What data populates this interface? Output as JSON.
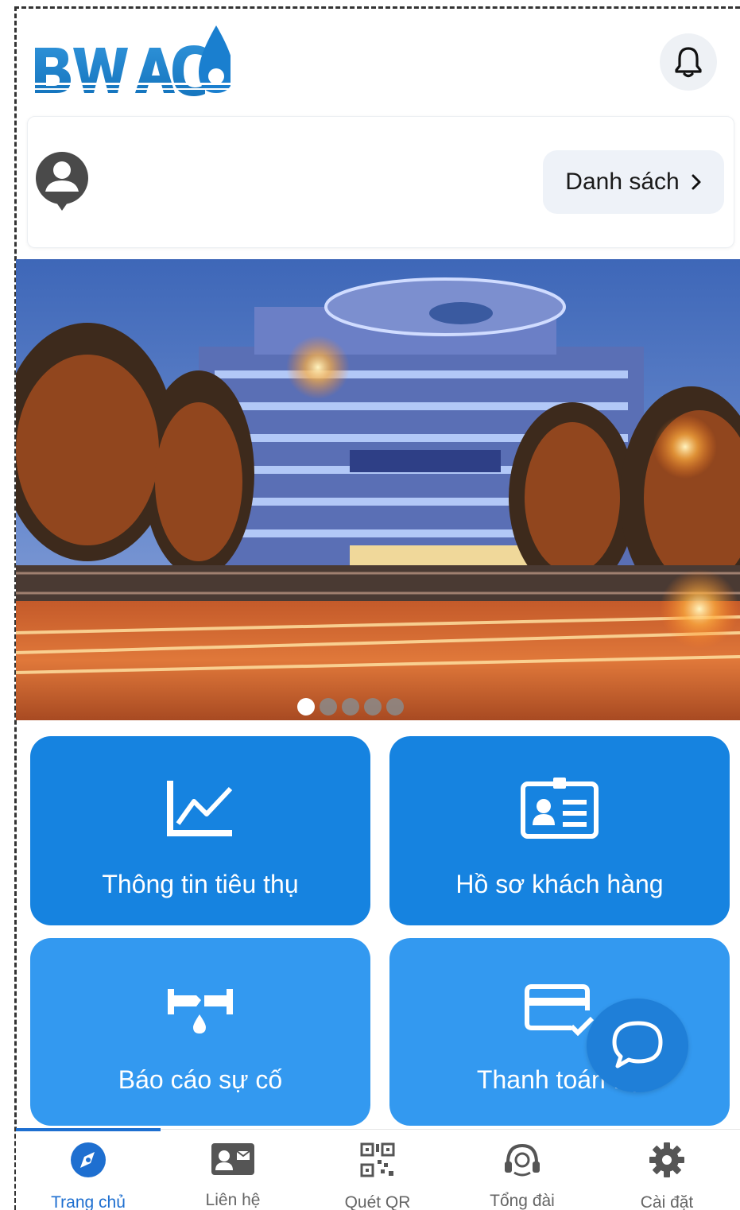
{
  "header": {
    "logo_text": "BWACO",
    "notification_icon": "bell-icon"
  },
  "account": {
    "avatar_icon": "user-avatar-icon",
    "list_button_label": "Danh sách",
    "list_button_icon": "chevron-right-icon"
  },
  "banner": {
    "slides": 5,
    "active_slide": 1
  },
  "tiles": [
    {
      "label": "Thông tin tiêu thụ",
      "icon": "line-chart-icon"
    },
    {
      "label": "Hồ sơ khách hàng",
      "icon": "id-card-icon"
    },
    {
      "label": "Báo cáo sự cố",
      "icon": "pipe-leak-icon"
    },
    {
      "label": "Thanh toán trụ",
      "icon": "credit-card-check-icon"
    }
  ],
  "chat": {
    "icon": "chat-bubble-icon"
  },
  "tabbar": {
    "items": [
      {
        "label": "Trang chủ",
        "icon": "compass-icon",
        "active": true
      },
      {
        "label": "Liên hệ",
        "icon": "contact-card-icon",
        "active": false
      },
      {
        "label": "Quét QR",
        "icon": "qr-code-icon",
        "active": false
      },
      {
        "label": "Tổng đài",
        "icon": "headset-icon",
        "active": false
      },
      {
        "label": "Cài đặt",
        "icon": "gear-icon",
        "active": false
      }
    ]
  },
  "colors": {
    "primary_tile": "#1683e0",
    "secondary_tile": "#3399f0",
    "active_tab": "#1e6fd0",
    "brand_blue": "#1f86cc"
  }
}
